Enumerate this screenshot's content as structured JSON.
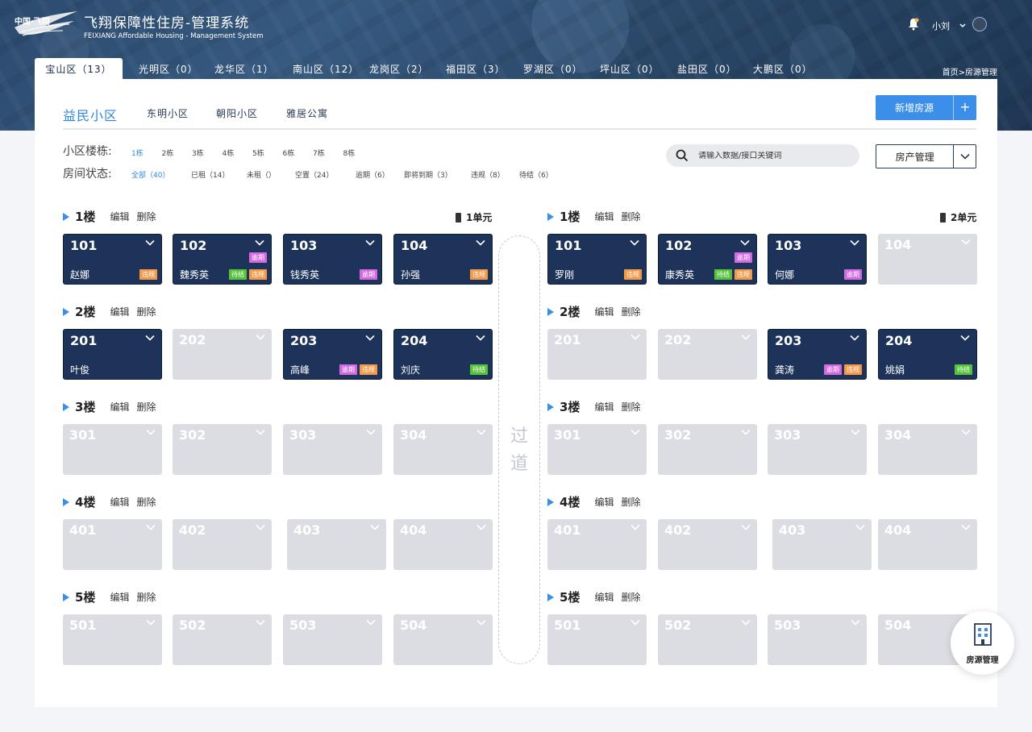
{
  "header": {
    "logo_text": "中国·飞翔",
    "title_cn": "飞翔保障性住房-管理系统",
    "title_en": "FEIXIANG Affordable Housing - Management System",
    "username": "小刘",
    "breadcrumb": "首页>房源管理"
  },
  "district_tabs": [
    {
      "label": "宝山区（13）",
      "active": true
    },
    {
      "label": "光明区（0）"
    },
    {
      "label": "龙华区（1）"
    },
    {
      "label": "南山区（12）"
    },
    {
      "label": "龙岗区（2）"
    },
    {
      "label": "福田区（3）"
    },
    {
      "label": "罗湖区（0）"
    },
    {
      "label": "坪山区（0）"
    },
    {
      "label": "盐田区（0）"
    },
    {
      "label": "大鹏区（0）"
    }
  ],
  "community_tabs": [
    {
      "label": "益民小区",
      "active": true
    },
    {
      "label": "东明小区"
    },
    {
      "label": "朝阳小区"
    },
    {
      "label": "雅居公寓"
    }
  ],
  "add_button": {
    "label": "新增房源",
    "plus": "+"
  },
  "filters": {
    "building_label": "小区楼栋:",
    "buildings": [
      "1栋",
      "2栋",
      "3栋",
      "4栋",
      "5栋",
      "6栋",
      "7栋",
      "8栋"
    ],
    "status_label": "房间状态:",
    "statuses": [
      "全部（40）",
      "已租（14）",
      "未租（）",
      "空置（24）",
      "逾期（6）",
      "即将到期（3）",
      "违规（8）",
      "待结（6）"
    ]
  },
  "search": {
    "placeholder": "请输入数据/接口关键词"
  },
  "property_select": {
    "label": "房产管理"
  },
  "floor_actions": {
    "edit": "编辑",
    "delete": "删除"
  },
  "units": [
    {
      "name": "1单元",
      "floors": [
        {
          "name": "1楼",
          "rooms": [
            {
              "num": "101",
              "tenant": "赵娜",
              "tags": [
                "违规"
              ]
            },
            {
              "num": "102",
              "tenant": "魏秀英",
              "top_tag": "逾期",
              "tags": [
                "待结",
                "违规"
              ]
            },
            {
              "num": "103",
              "tenant": "钱秀英",
              "tags": [
                "逾期"
              ]
            },
            {
              "num": "104",
              "tenant": "孙强",
              "tags": [
                "违规"
              ]
            }
          ]
        },
        {
          "name": "2楼",
          "rooms": [
            {
              "num": "201",
              "tenant": "叶俊",
              "tags": []
            },
            {
              "num": "202"
            },
            {
              "num": "203",
              "tenant": "高峰",
              "tags": [
                "逾期",
                "违规"
              ]
            },
            {
              "num": "204",
              "tenant": "刘庆",
              "tags": [
                "待结"
              ]
            }
          ]
        },
        {
          "name": "3楼",
          "rooms": [
            {
              "num": "301"
            },
            {
              "num": "302"
            },
            {
              "num": "303"
            },
            {
              "num": "304"
            }
          ]
        },
        {
          "name": "4楼",
          "rooms": [
            {
              "num": "401"
            },
            {
              "num": "402"
            },
            {
              "num": "403"
            },
            {
              "num": "404"
            }
          ]
        },
        {
          "name": "5楼",
          "rooms": [
            {
              "num": "501"
            },
            {
              "num": "502"
            },
            {
              "num": "503"
            },
            {
              "num": "504"
            }
          ]
        }
      ]
    },
    {
      "name": "2单元",
      "floors": [
        {
          "name": "1楼",
          "rooms": [
            {
              "num": "101",
              "tenant": "罗刚",
              "tags": [
                "违规"
              ]
            },
            {
              "num": "102",
              "tenant": "康秀英",
              "top_tag": "逾期",
              "tags": [
                "待结",
                "违规"
              ]
            },
            {
              "num": "103",
              "tenant": "何娜",
              "tags": [
                "逾期"
              ]
            },
            {
              "num": "104"
            }
          ]
        },
        {
          "name": "2楼",
          "rooms": [
            {
              "num": "201"
            },
            {
              "num": "202"
            },
            {
              "num": "203",
              "tenant": "龚涛",
              "tags": [
                "逾期",
                "违规"
              ]
            },
            {
              "num": "204",
              "tenant": "姚娟",
              "tags": [
                "待结"
              ]
            }
          ]
        },
        {
          "name": "3楼",
          "rooms": [
            {
              "num": "301"
            },
            {
              "num": "302"
            },
            {
              "num": "303"
            },
            {
              "num": "304"
            }
          ]
        },
        {
          "name": "4楼",
          "rooms": [
            {
              "num": "401"
            },
            {
              "num": "402"
            },
            {
              "num": "403"
            },
            {
              "num": "404"
            }
          ]
        },
        {
          "name": "5楼",
          "rooms": [
            {
              "num": "501"
            },
            {
              "num": "502"
            },
            {
              "num": "503"
            },
            {
              "num": "504"
            }
          ]
        }
      ]
    }
  ],
  "corridor": {
    "label": "过道"
  },
  "fab": {
    "label": "房源管理"
  },
  "colors": {
    "accent": "#3b8fe8",
    "occupied": "#1e3359",
    "empty": "#dcdde2",
    "weigui": "#f29a4b",
    "yuqi": "#d369e0",
    "daijie": "#56c23a"
  }
}
